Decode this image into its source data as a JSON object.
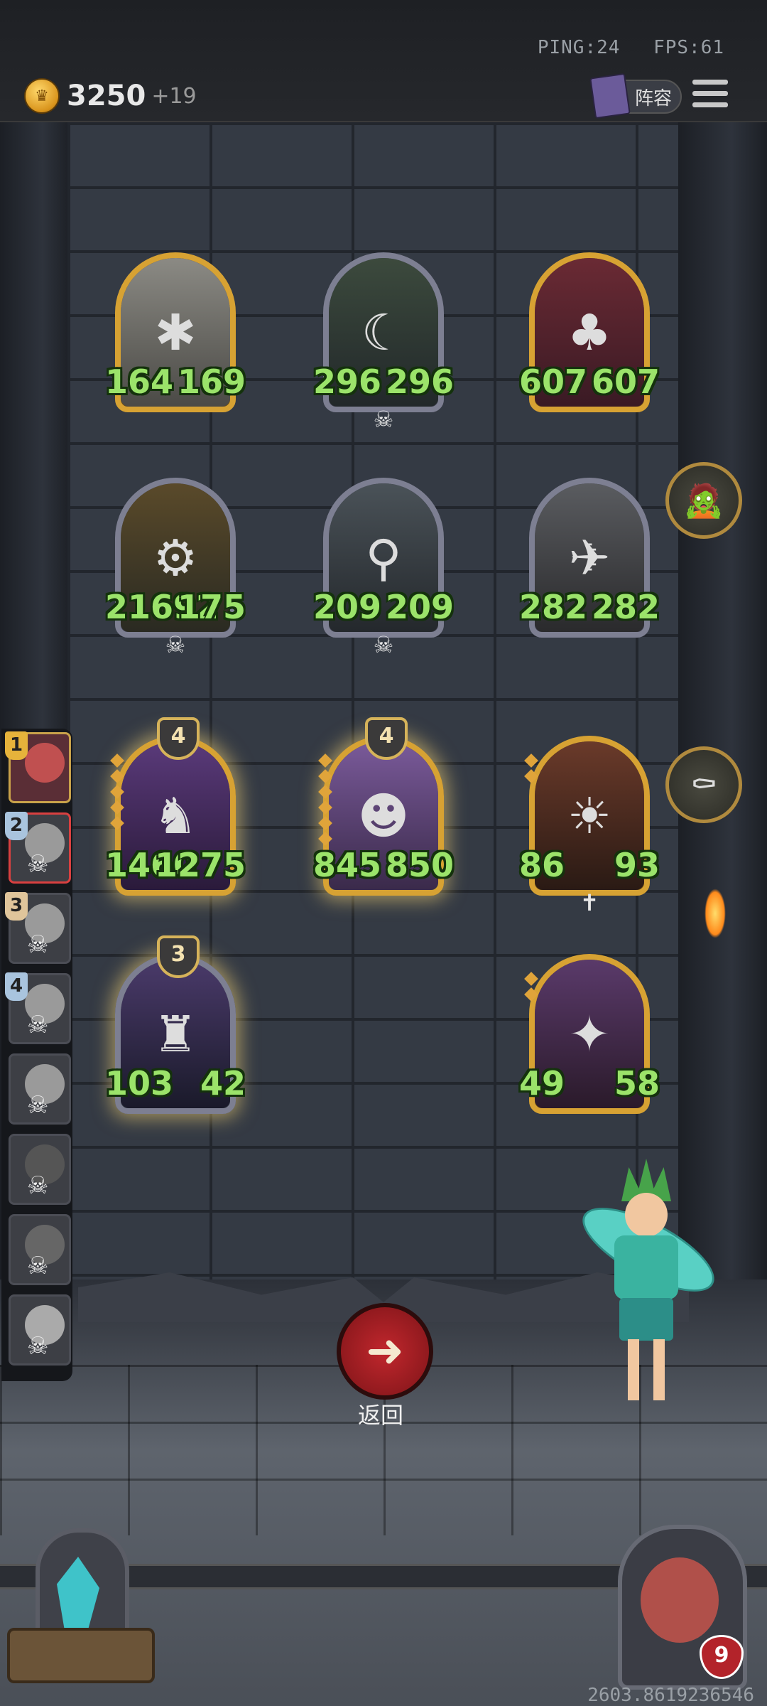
{
  "header": {
    "ping_label": "PING:24",
    "fps_label": "FPS:61",
    "gold_amount": "3250",
    "gold_income": "+19",
    "lineup_label": "阵容"
  },
  "board": [
    {
      "name": "windmill",
      "attack": "164",
      "health": "169",
      "frame": "gold"
    },
    {
      "name": "horned-elf-woman",
      "attack": "296",
      "health": "296",
      "frame": "silver"
    },
    {
      "name": "evil-clown",
      "attack": "607",
      "health": "607",
      "frame": "gold"
    },
    {
      "name": "golden-golem",
      "attack": "21692",
      "health": "175",
      "frame": "silver"
    },
    {
      "name": "robot-bucket",
      "attack": "209",
      "health": "209",
      "frame": "silver"
    },
    {
      "name": "airship",
      "attack": "282",
      "health": "282",
      "frame": "silver"
    },
    {
      "name": "dark-dragon",
      "attack": "1460",
      "health": "1275",
      "frame": "gold",
      "level": "4"
    },
    {
      "name": "mad-scientist",
      "attack": "845",
      "health": "850",
      "frame": "gold",
      "level": "4"
    },
    {
      "name": "sun-priest",
      "attack": "86",
      "health": "93",
      "frame": "gold"
    },
    {
      "name": "shadow-knight",
      "attack": "103",
      "health": "42",
      "frame": "silver",
      "level": "3"
    },
    {
      "name": "bat-beast",
      "attack": "49",
      "health": "58",
      "frame": "gold"
    }
  ],
  "players": [
    {
      "rank": "1",
      "status": "active"
    },
    {
      "rank": "2",
      "status": "dead-selected"
    },
    {
      "rank": "3",
      "status": "dead"
    },
    {
      "rank": "4",
      "status": "dead"
    },
    {
      "rank": "",
      "status": "dead"
    },
    {
      "rank": "",
      "status": "dead"
    },
    {
      "rank": "",
      "status": "dead"
    },
    {
      "rank": "",
      "status": "dead"
    }
  ],
  "return_label": "返回",
  "hero_health": "9",
  "seed_text": "2603.8619236546",
  "icons": {
    "coin": "crown-coin-icon",
    "menu": "menu-icon",
    "return": "arrow-left-icon",
    "side1": "zombie-figure-icon",
    "side2": "coffin-icon"
  }
}
